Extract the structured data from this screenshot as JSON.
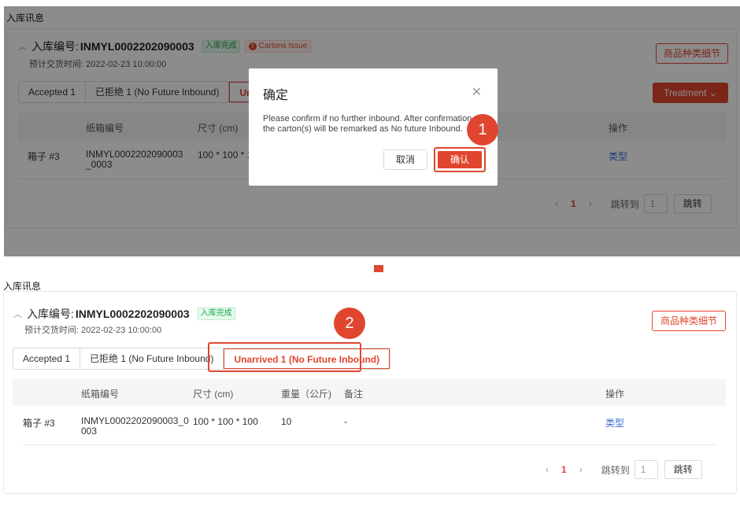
{
  "top": {
    "section_title": "入库讯息",
    "inbound_label": "入库编号:",
    "inbound_no": "INMYL0002202090003",
    "status_tag": "入库完成",
    "issue_tag": "Cartons Issue",
    "eta": "预计交货时间: 2022-02-23 10:00:00",
    "detail_button": "商品种类细节",
    "treatment_button": "Treatment",
    "tabs": [
      {
        "label": "Accepted 1"
      },
      {
        "label": "已拒绝 1 (No Future Inbound)"
      },
      {
        "label": "Unarri"
      }
    ],
    "columns": [
      "纸箱编号",
      "尺寸 (cm)",
      "操作"
    ],
    "row": {
      "box": "箱子 #3",
      "carton_no": "INMYL0002202090003_0003",
      "size": "100 * 100 * 1",
      "action": "类型"
    },
    "pager": {
      "current": "1",
      "jump_label": "跳转到",
      "jump_value": "1",
      "jump_button": "跳转"
    }
  },
  "modal": {
    "title": "确定",
    "body_line1": "Please confirm if no further inbound. After confirmation",
    "body_line2": "the carton(s) will be remarked as No future Inbound.",
    "cancel": "取消",
    "confirm": "确认"
  },
  "steps": {
    "one": "1",
    "two": "2"
  },
  "bottom": {
    "section_title": "入库讯息",
    "inbound_label": "入库编号:",
    "inbound_no": "INMYL0002202090003",
    "status_tag": "入库完成",
    "eta": "预计交货时间: 2022-02-23 10:00:00",
    "detail_button": "商品种类细节",
    "tabs": [
      {
        "label": "Accepted 1"
      },
      {
        "label": "已拒绝 1 (No Future Inbound)"
      },
      {
        "label": "Unarrived 1 (No Future Inbound)"
      }
    ],
    "columns": [
      "纸箱编号",
      "尺寸 (cm)",
      "重量（公斤)",
      "备注",
      "操作"
    ],
    "row": {
      "box": "箱子 #3",
      "carton_no_1": "INMYL0002202090003_0",
      "carton_no_2": "003",
      "size": "100 * 100 * 100",
      "weight": "10",
      "note": "-",
      "action": "类型"
    },
    "pager": {
      "current": "1",
      "jump_label": "跳转到",
      "jump_value": "1",
      "jump_button": "跳转"
    }
  },
  "colors": {
    "accent": "#e0462f",
    "link": "#3b6ed6",
    "success": "#17a34a"
  }
}
